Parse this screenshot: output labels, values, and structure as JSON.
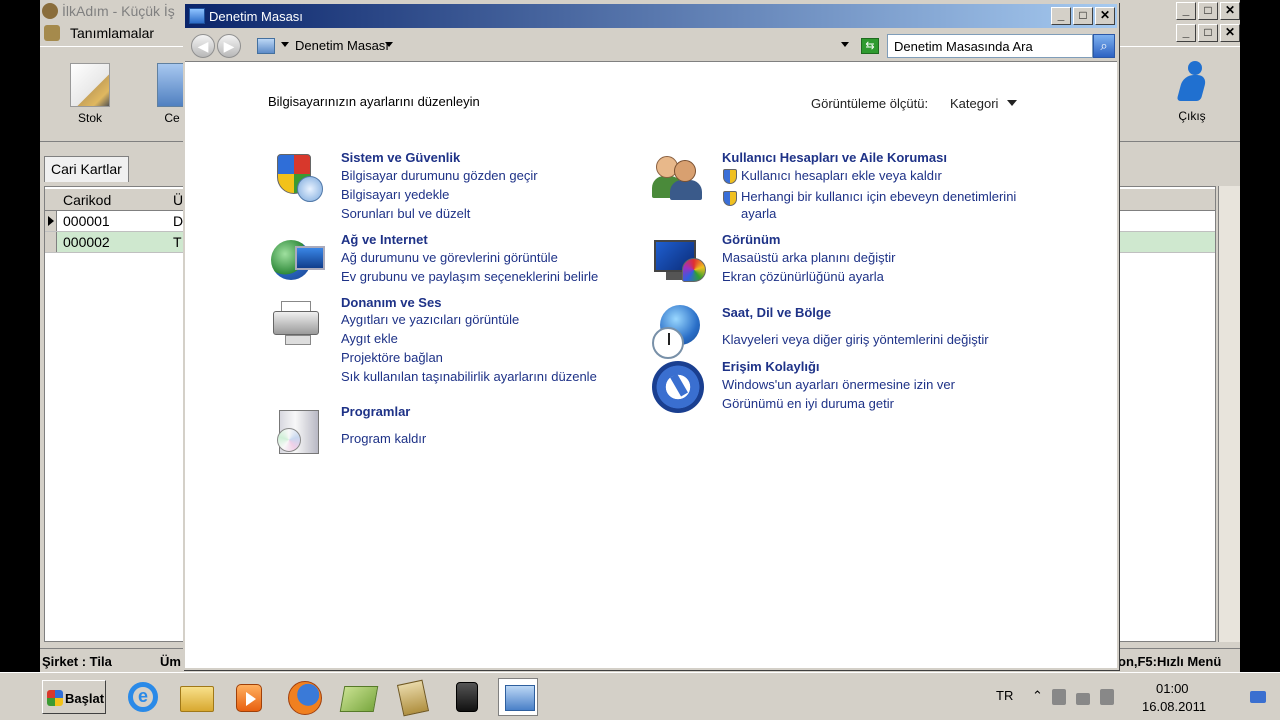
{
  "bg_app": {
    "title": "İlkAdım - Küçük İş",
    "menu_item": "Tanımlamalar",
    "tools": {
      "stok": "Stok",
      "ce": "Ce",
      "cikis": "Çıkış"
    },
    "tab": "Cari Kartlar",
    "grid": {
      "columns": [
        "Carikod",
        "Ü"
      ],
      "rows": [
        {
          "code": "000001",
          "col2": "D"
        },
        {
          "code": "000002",
          "col2": "T"
        }
      ]
    },
    "status_left": "Şirket : Tila",
    "status_mid": "Üm",
    "status_right": "on,F5:Hızlı Menü"
  },
  "window": {
    "title": "Denetim Masası",
    "breadcrumb": "Denetim Masası",
    "search_placeholder": "Denetim Masasında Ara"
  },
  "content": {
    "heading": "Bilgisayarınızın ayarlarını düzenleyin",
    "view_by_label": "Görüntüleme ölçütü:",
    "view_by_value": "Kategori",
    "categories": {
      "security": {
        "title": "Sistem ve Güvenlik",
        "links": [
          "Bilgisayar durumunu gözden geçir",
          "Bilgisayarı yedekle",
          "Sorunları bul ve düzelt"
        ]
      },
      "network": {
        "title": "Ağ ve Internet",
        "links": [
          "Ağ durumunu ve görevlerini görüntüle",
          "Ev grubunu ve paylaşım seçeneklerini belirle"
        ]
      },
      "hardware": {
        "title": "Donanım ve Ses",
        "links": [
          "Aygıtları ve yazıcıları görüntüle",
          "Aygıt ekle",
          "Projektöre bağlan",
          "Sık kullanılan taşınabilirlik ayarlarını düzenle"
        ]
      },
      "programs": {
        "title": "Programlar",
        "links": [
          "Program kaldır"
        ]
      },
      "users": {
        "title": "Kullanıcı Hesapları ve Aile Koruması",
        "links": [
          "Kullanıcı hesapları ekle veya kaldır",
          "Herhangi bir kullanıcı için ebeveyn denetimlerini",
          "ayarla"
        ]
      },
      "appearance": {
        "title": "Görünüm",
        "links": [
          "Masaüstü arka planını değiştir",
          "Ekran çözünürlüğünü ayarla"
        ]
      },
      "clock": {
        "title": "Saat, Dil ve Bölge",
        "links": [
          "Klavyeleri veya diğer giriş yöntemlerini değiştir"
        ]
      },
      "ease": {
        "title": "Erişim Kolaylığı",
        "links": [
          "Windows'un ayarları önermesine izin ver",
          "Görünümü en iyi duruma getir"
        ]
      }
    }
  },
  "taskbar": {
    "start_label": "Başlat",
    "language": "TR",
    "time": "01:00",
    "date": "16.08.2011",
    "tray_chevron": "⌃"
  },
  "icons": {
    "minimize": "_",
    "maximize": "□",
    "close": "✕",
    "search_glyph": "⌕",
    "refresh_glyph": "⇆",
    "ie_glyph": "e"
  }
}
